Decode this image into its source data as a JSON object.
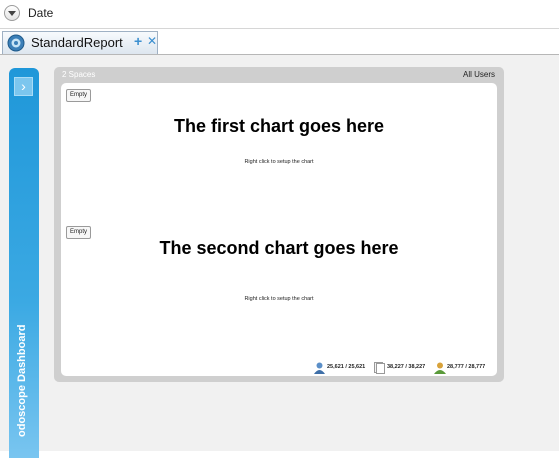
{
  "datebar": {
    "label": "Date"
  },
  "tab": {
    "title": "StandardReport",
    "add_symbol": "+",
    "close_symbol": "✕"
  },
  "sidebar": {
    "toggle_symbol": "›",
    "title": "odoscope Dashboard"
  },
  "panel": {
    "header_left": "2 Spaces",
    "header_right": "All Users",
    "charts": [
      {
        "empty_label": "Empty",
        "title": "The first chart goes here",
        "hint": "Right click to setup the chart"
      },
      {
        "empty_label": "Empty",
        "title": "The second chart goes here",
        "hint": "Right click to setup the chart"
      }
    ],
    "stats": [
      {
        "icon": "user-icon",
        "value": "25,621 / 25,621"
      },
      {
        "icon": "page-icon",
        "value": "38,227 / 38,227"
      },
      {
        "icon": "users-icon",
        "value": "28,777 / 28,777"
      }
    ]
  },
  "colors": {
    "sidebar": "#1f97d9",
    "panel": "#cfcfcf",
    "accent": "#3b8fd0"
  }
}
